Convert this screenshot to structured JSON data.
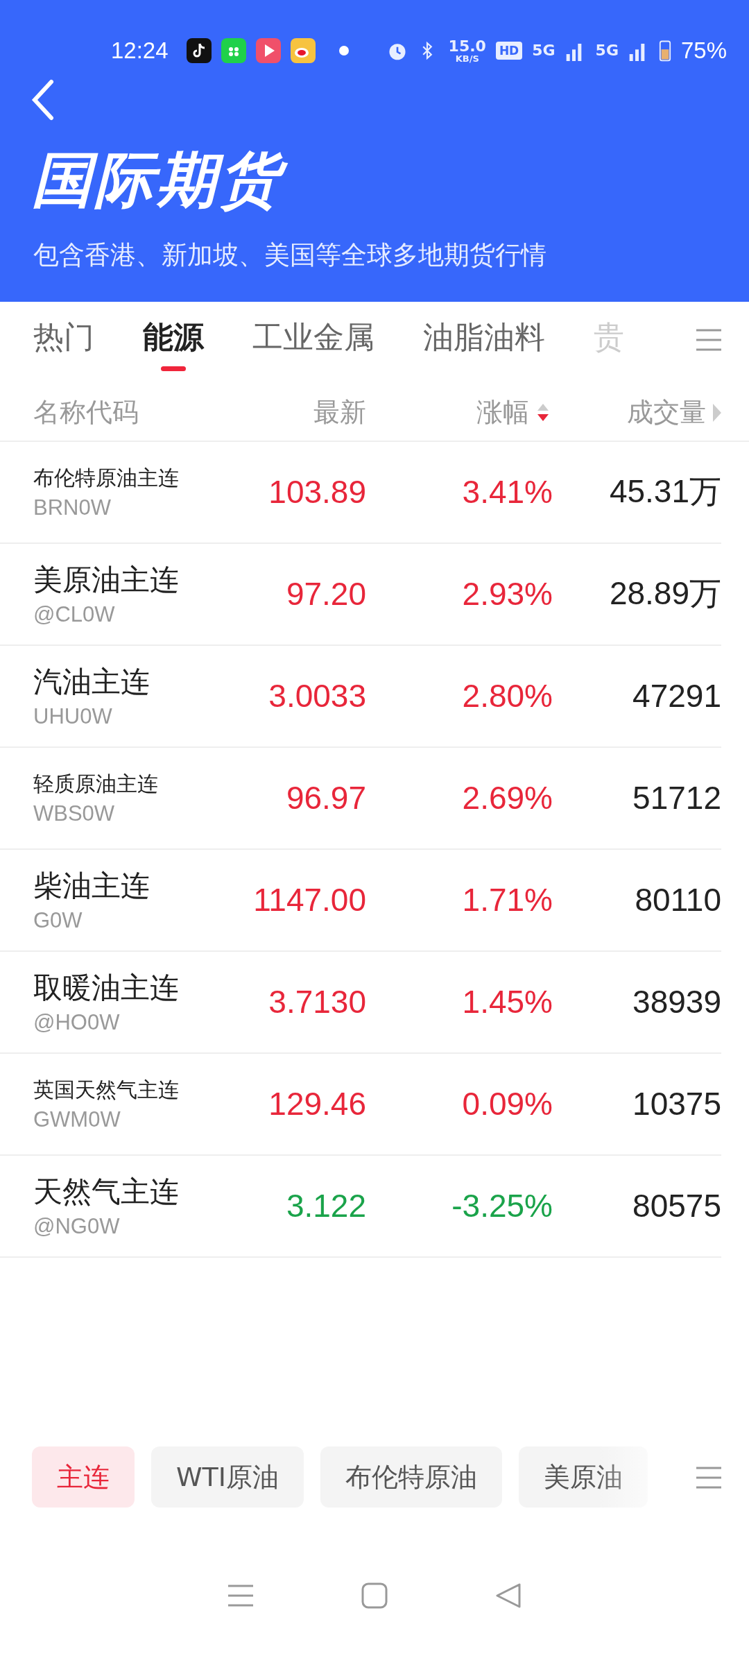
{
  "status_bar": {
    "time": "12:24",
    "speed": "15.0",
    "speed_unit": "KB/S",
    "hd": "HD",
    "network_1": "5G",
    "network_2": "5G",
    "battery": "75%"
  },
  "header": {
    "title": "国际期货",
    "subtitle": "包含香港、新加坡、美国等全球多地期货行情"
  },
  "tabs": [
    {
      "label": "热门",
      "selected": false
    },
    {
      "label": "能源",
      "selected": true
    },
    {
      "label": "工业金属",
      "selected": false
    },
    {
      "label": "油脂油料",
      "selected": false
    },
    {
      "label": "贵",
      "selected": false
    }
  ],
  "table": {
    "columns": [
      "名称代码",
      "最新",
      "涨幅",
      "成交量"
    ],
    "rows": [
      {
        "name": "布伦特原油主连",
        "code": "BRN0W",
        "price": "103.89",
        "change": "3.41%",
        "volume": "45.31万",
        "color": "#e8263a"
      },
      {
        "name": "美原油主连",
        "code": "@CL0W",
        "price": "97.20",
        "change": "2.93%",
        "volume": "28.89万",
        "color": "#e8263a"
      },
      {
        "name": "汽油主连",
        "code": "UHU0W",
        "price": "3.0033",
        "change": "2.80%",
        "volume": "47291",
        "color": "#e8263a"
      },
      {
        "name": "轻质原油主连",
        "code": "WBS0W",
        "price": "96.97",
        "change": "2.69%",
        "volume": "51712",
        "color": "#e8263a"
      },
      {
        "name": "柴油主连",
        "code": "G0W",
        "price": "1147.00",
        "change": "1.71%",
        "volume": "80110",
        "color": "#e8263a"
      },
      {
        "name": "取暖油主连",
        "code": "@HO0W",
        "price": "3.7130",
        "change": "1.45%",
        "volume": "38939",
        "color": "#e8263a"
      },
      {
        "name": "英国天然气主连",
        "code": "GWM0W",
        "price": "129.46",
        "change": "0.09%",
        "volume": "10375",
        "color": "#e8263a"
      },
      {
        "name": "天然气主连",
        "code": "@NG0W",
        "price": "3.122",
        "change": "-3.25%",
        "volume": "80575",
        "color": "#1aa34a"
      }
    ]
  },
  "chips": [
    {
      "label": "主连",
      "selected": true
    },
    {
      "label": "WTI原油",
      "selected": false
    },
    {
      "label": "布伦特原油",
      "selected": false
    },
    {
      "label": "美原油",
      "selected": false
    }
  ]
}
